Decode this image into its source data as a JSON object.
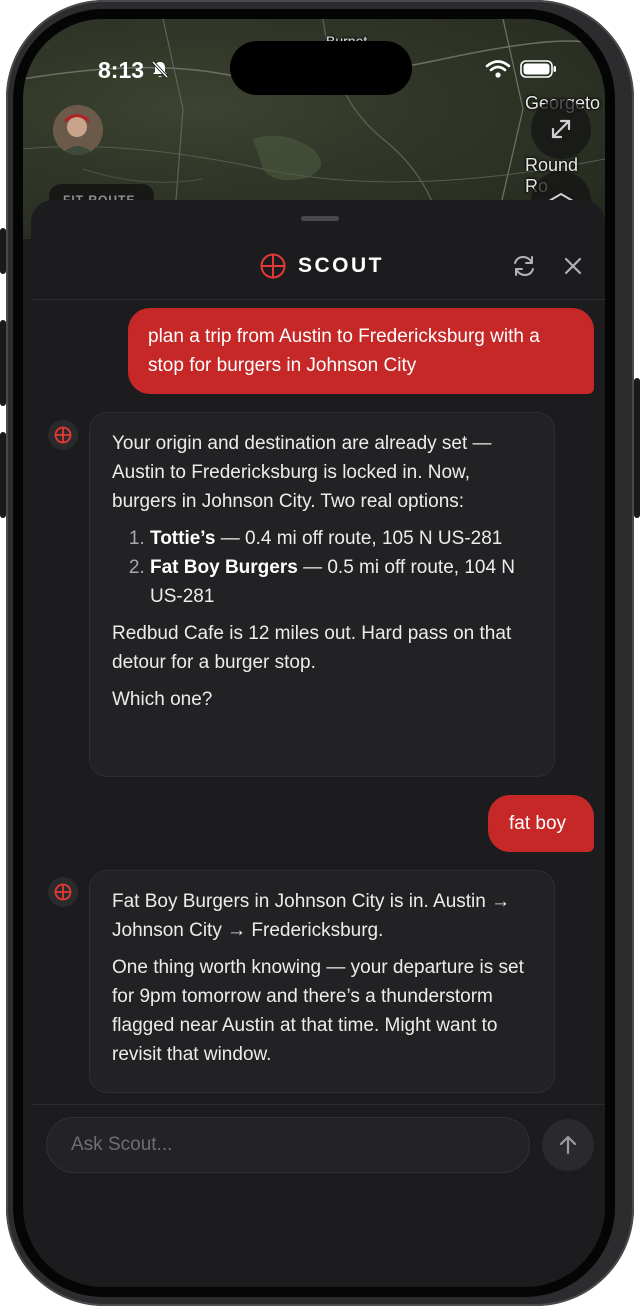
{
  "status_bar": {
    "time": "8:13"
  },
  "map": {
    "labels": [
      "Georgeto",
      "Round Ro",
      "Burnet"
    ],
    "fit_route_label": "FIT ROUTE"
  },
  "header": {
    "title": "SCOUT"
  },
  "conversation": {
    "user_1": "plan a trip from Austin to Fredericksburg with a stop for burgers in Johnson City",
    "bot_1": {
      "intro": "Your origin and destination are already set — Austin to Fredericksburg is locked in. Now, burgers in Johnson City. Two real options:",
      "options": [
        {
          "name": "Tottie’s",
          "detail": " — 0.4 mi off route, 105 N US-281"
        },
        {
          "name": "Fat Boy Burgers",
          "detail": " — 0.5 mi off route, 104 N US-281"
        }
      ],
      "note": "Redbud Cafe is 12 miles out. Hard pass on that detour for a burger stop.",
      "question": "Which one?"
    },
    "user_2": "fat boy",
    "bot_2": {
      "p1": "Fat Boy Burgers in Johnson City is in. Austin → Johnson City → Fredericksburg.",
      "p2": "One thing worth knowing — your departure is set for 9pm tomorrow and there’s a thunderstorm flagged near Austin at that time. Might want to revisit that window."
    }
  },
  "composer": {
    "placeholder": "Ask Scout..."
  },
  "colors": {
    "accent": "#c62828",
    "sheet": "#1c1c1e",
    "bubble": "#222224"
  }
}
